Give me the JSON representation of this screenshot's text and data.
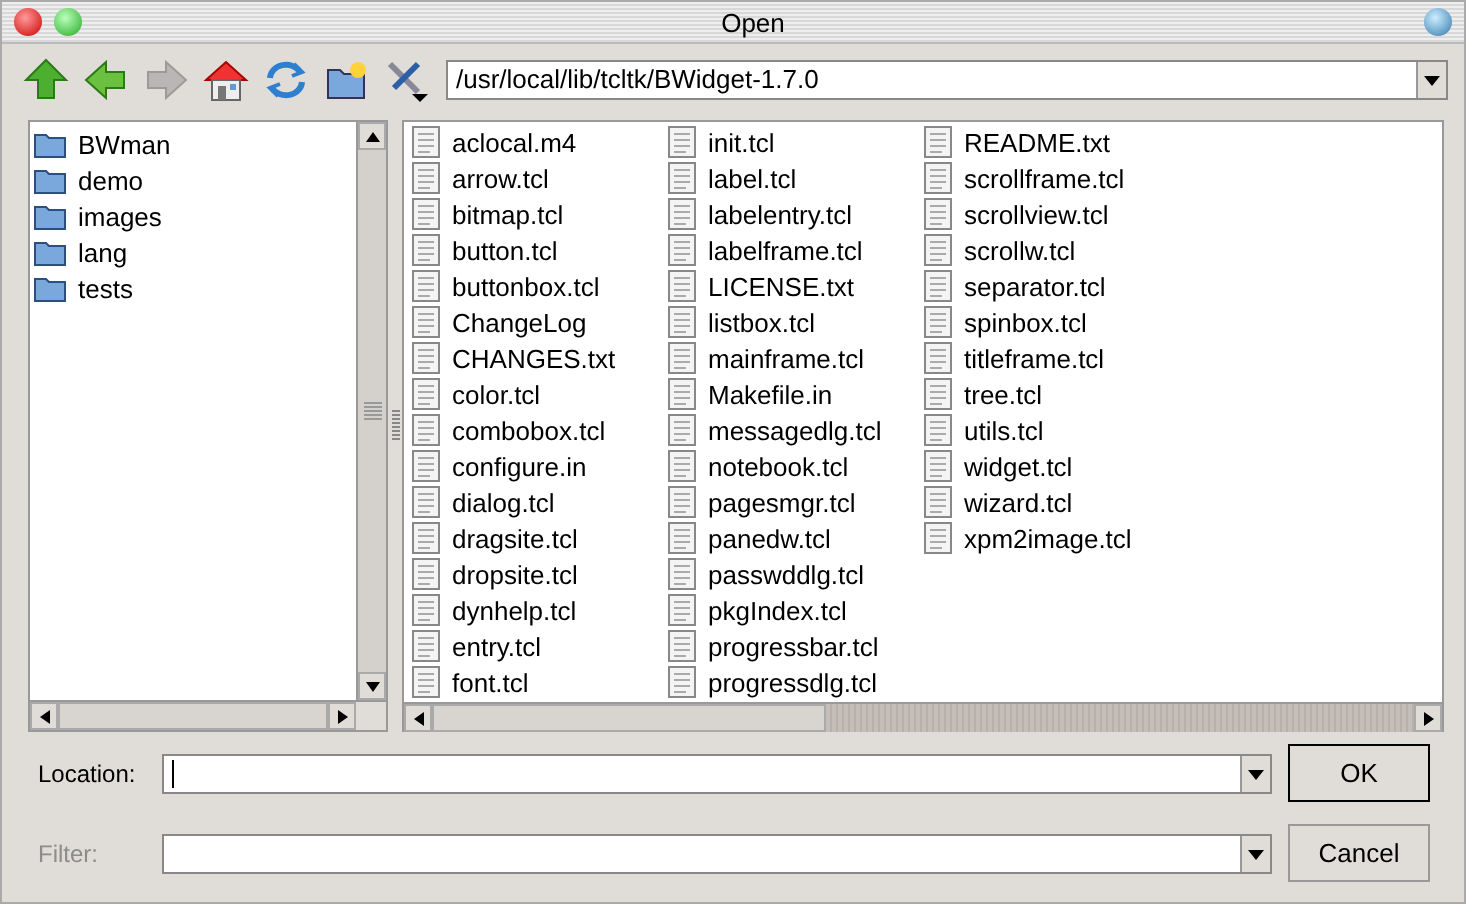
{
  "window": {
    "title": "Open"
  },
  "toolbar": [
    {
      "kind": "up",
      "disabled": false
    },
    {
      "kind": "back",
      "disabled": false
    },
    {
      "kind": "forward",
      "disabled": true
    },
    {
      "kind": "home",
      "disabled": false
    },
    {
      "kind": "refresh",
      "disabled": false
    },
    {
      "kind": "newfolder",
      "disabled": false
    },
    {
      "kind": "tools",
      "disabled": false
    }
  ],
  "path": {
    "value": "/usr/local/lib/tcltk/BWidget-1.7.0"
  },
  "folders": [
    "BWman",
    "demo",
    "images",
    "lang",
    "tests"
  ],
  "files": [
    "aclocal.m4",
    "arrow.tcl",
    "bitmap.tcl",
    "button.tcl",
    "buttonbox.tcl",
    "ChangeLog",
    "CHANGES.txt",
    "color.tcl",
    "combobox.tcl",
    "configure.in",
    "dialog.tcl",
    "dragsite.tcl",
    "dropsite.tcl",
    "dynhelp.tcl",
    "entry.tcl",
    "font.tcl",
    "init.tcl",
    "label.tcl",
    "labelentry.tcl",
    "labelframe.tcl",
    "LICENSE.txt",
    "listbox.tcl",
    "mainframe.tcl",
    "Makefile.in",
    "messagedlg.tcl",
    "notebook.tcl",
    "pagesmgr.tcl",
    "panedw.tcl",
    "passwddlg.tcl",
    "pkgIndex.tcl",
    "progressbar.tcl",
    "progressdlg.tcl",
    "README.txt",
    "scrollframe.tcl",
    "scrollview.tcl",
    "scrollw.tcl",
    "separator.tcl",
    "spinbox.tcl",
    "titleframe.tcl",
    "tree.tcl",
    "utils.tcl",
    "widget.tcl",
    "wizard.tcl",
    "xpm2image.tcl"
  ],
  "location": {
    "label": "Location:",
    "disabled": false
  },
  "filter": {
    "label": "Filter:",
    "disabled": true
  },
  "buttons": [
    {
      "label": "OK",
      "default": true
    },
    {
      "label": "Cancel",
      "default": false
    }
  ]
}
